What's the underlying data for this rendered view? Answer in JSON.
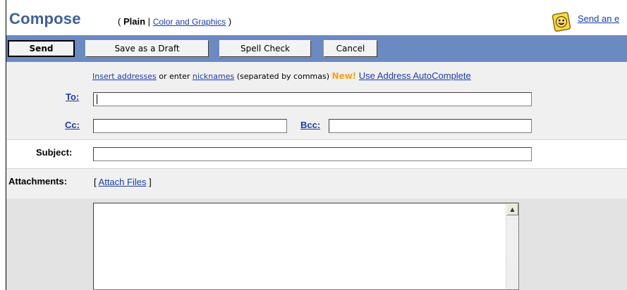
{
  "header": {
    "title": "Compose",
    "modes_open": "(",
    "plain_label": "Plain",
    "separator": "|",
    "color_graphics_link": "Color and Graphics",
    "modes_close": ")",
    "ecard_link": "Send an e"
  },
  "toolbar": {
    "send_label": "Send",
    "draft_label": "Save as a Draft",
    "spell_label": "Spell Check",
    "cancel_label": "Cancel"
  },
  "addresses": {
    "insert_link": "Insert addresses",
    "or_enter": "or enter",
    "nicknames_link": "nicknames",
    "separated_note": "(separated by commas)",
    "new_badge": "New!",
    "autocomplete_link": "Use Address AutoComplete",
    "to_label": "To:",
    "cc_label": "Cc:",
    "bcc_label": "Bcc:",
    "to_value": "",
    "cc_value": "",
    "bcc_value": ""
  },
  "subject": {
    "label": "Subject:",
    "value": ""
  },
  "attachments": {
    "label": "Attachments:",
    "open_bracket": "[",
    "attach_link": "Attach Files",
    "close_bracket": "]"
  },
  "message": {
    "body": ""
  },
  "colors": {
    "toolbar_bg": "#6c8ac2",
    "title_color": "#3f5f9a",
    "link_color": "#1a3caa",
    "new_badge_color": "#f4a31a",
    "panel_bg": "#f0f0f0"
  },
  "icons": {
    "ecard_icon": "smiley-card-icon",
    "scroll_up_icon": "scroll-up-arrow-icon"
  }
}
